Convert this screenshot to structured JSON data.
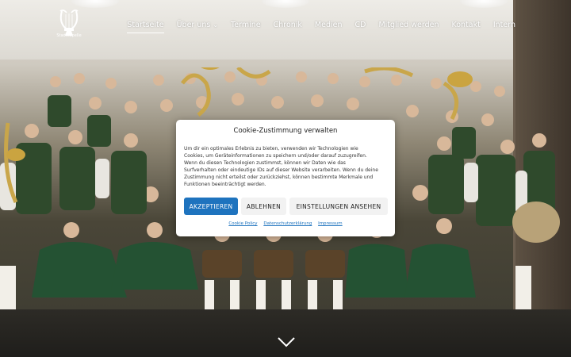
{
  "header": {
    "logo_caption": "Stadtkapelle",
    "nav": [
      {
        "label": "Startseite"
      },
      {
        "label": "Über uns"
      },
      {
        "label": "Termine"
      },
      {
        "label": "Chronik"
      },
      {
        "label": "Medien"
      },
      {
        "label": "CD"
      },
      {
        "label": "Mitglied werden"
      },
      {
        "label": "Kontakt"
      },
      {
        "label": "Intern"
      }
    ]
  },
  "cookie": {
    "title": "Cookie-Zustimmung verwalten",
    "text": "Um dir ein optimales Erlebnis zu bieten, verwenden wir Technologien wie Cookies, um Geräteinformationen zu speichern und/oder darauf zuzugreifen. Wenn du diesen Technologien zustimmst, können wir Daten wie das Surfverhalten oder eindeutige IDs auf dieser Website verarbeiten. Wenn du deine Zustimmung nicht erteilst oder zurückziehst, können bestimmte Merkmale und Funktionen beeinträchtigt werden.",
    "accept_label": "AKZEPTIEREN",
    "decline_label": "ABLEHNEN",
    "settings_label": "EINSTELLUNGEN ANSEHEN",
    "links": [
      "Cookie Policy",
      "Datenschutzerklärung",
      "Impressum"
    ]
  },
  "icons": {
    "logo": "lyre-icon",
    "submenu": "chevron-down-icon",
    "scroll": "chevron-down-icon"
  },
  "colors": {
    "accent": "#1e73be",
    "modal_bg": "#ffffff",
    "header_text": "#ffffff"
  }
}
